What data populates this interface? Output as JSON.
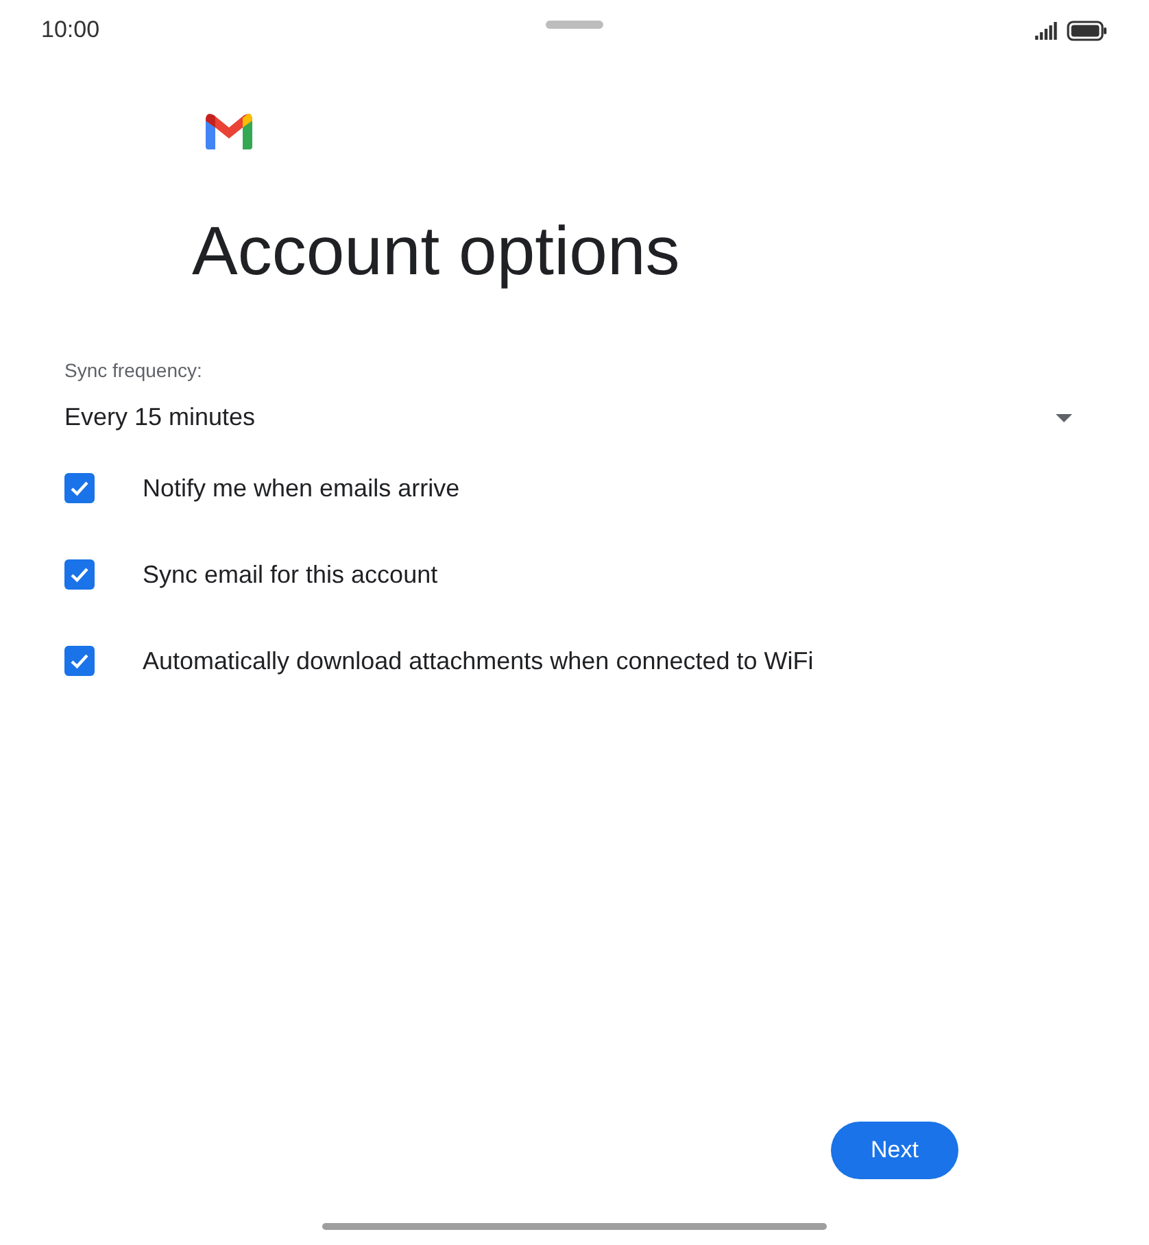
{
  "status_bar": {
    "time": "10:00"
  },
  "title": "Account options",
  "sync_frequency": {
    "label": "Sync frequency:",
    "value": "Every 15 minutes"
  },
  "options": [
    {
      "label": "Notify me when emails arrive",
      "checked": true
    },
    {
      "label": "Sync email for this account",
      "checked": true
    },
    {
      "label": "Automatically download attachments when connected to WiFi",
      "checked": true
    }
  ],
  "next_button": "Next"
}
